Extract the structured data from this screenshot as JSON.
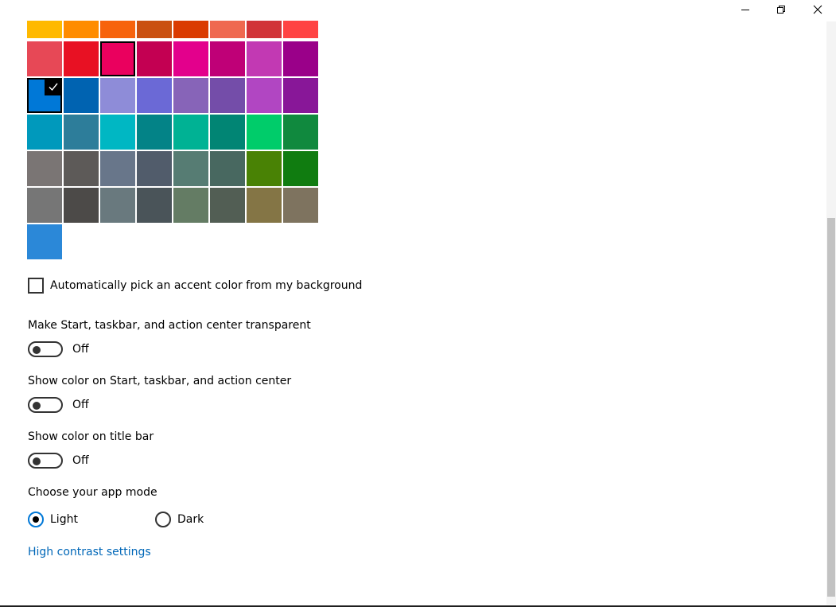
{
  "window": {
    "minimize_icon": "minimize-icon",
    "maximize_icon": "restore-icon",
    "close_icon": "close-icon"
  },
  "accent_colors": {
    "rows": [
      [
        "#FFB900",
        "#FF8C00",
        "#F7630C",
        "#CA5010",
        "#DA3B01",
        "#EF6950",
        "#D13438",
        "#FF4343"
      ],
      [
        "#E74856",
        "#E81123",
        "#EA005E",
        "#C30052",
        "#E3008C",
        "#BF0077",
        "#C239B3",
        "#9A0089"
      ],
      [
        "#0078D7",
        "#0063B1",
        "#8E8CD8",
        "#6B69D6",
        "#8764B8",
        "#744DA9",
        "#B146C2",
        "#881798"
      ],
      [
        "#0099BC",
        "#2D7D9A",
        "#00B7C3",
        "#038387",
        "#00B294",
        "#018574",
        "#00CC6A",
        "#10893E"
      ],
      [
        "#7A7574",
        "#5D5A58",
        "#68768A",
        "#515C6B",
        "#567C73",
        "#486860",
        "#498205",
        "#107C10"
      ],
      [
        "#767676",
        "#4C4A48",
        "#69797E",
        "#4A5459",
        "#647C64",
        "#525E54",
        "#847545",
        "#7E735F"
      ],
      [
        "#2B88D8"
      ]
    ],
    "selected": "#0078D7",
    "outlined": "#EA005E"
  },
  "auto_pick": {
    "label": "Automatically pick an accent color from my background",
    "checked": false
  },
  "transparency": {
    "title": "Make Start, taskbar, and action center transparent",
    "state": "Off"
  },
  "show_color_start": {
    "title": "Show color on Start, taskbar, and action center",
    "state": "Off"
  },
  "show_color_title": {
    "title": "Show color on title bar",
    "state": "Off"
  },
  "app_mode": {
    "title": "Choose your app mode",
    "options": [
      {
        "label": "Light",
        "selected": true
      },
      {
        "label": "Dark",
        "selected": false
      }
    ]
  },
  "high_contrast_link": "High contrast settings"
}
